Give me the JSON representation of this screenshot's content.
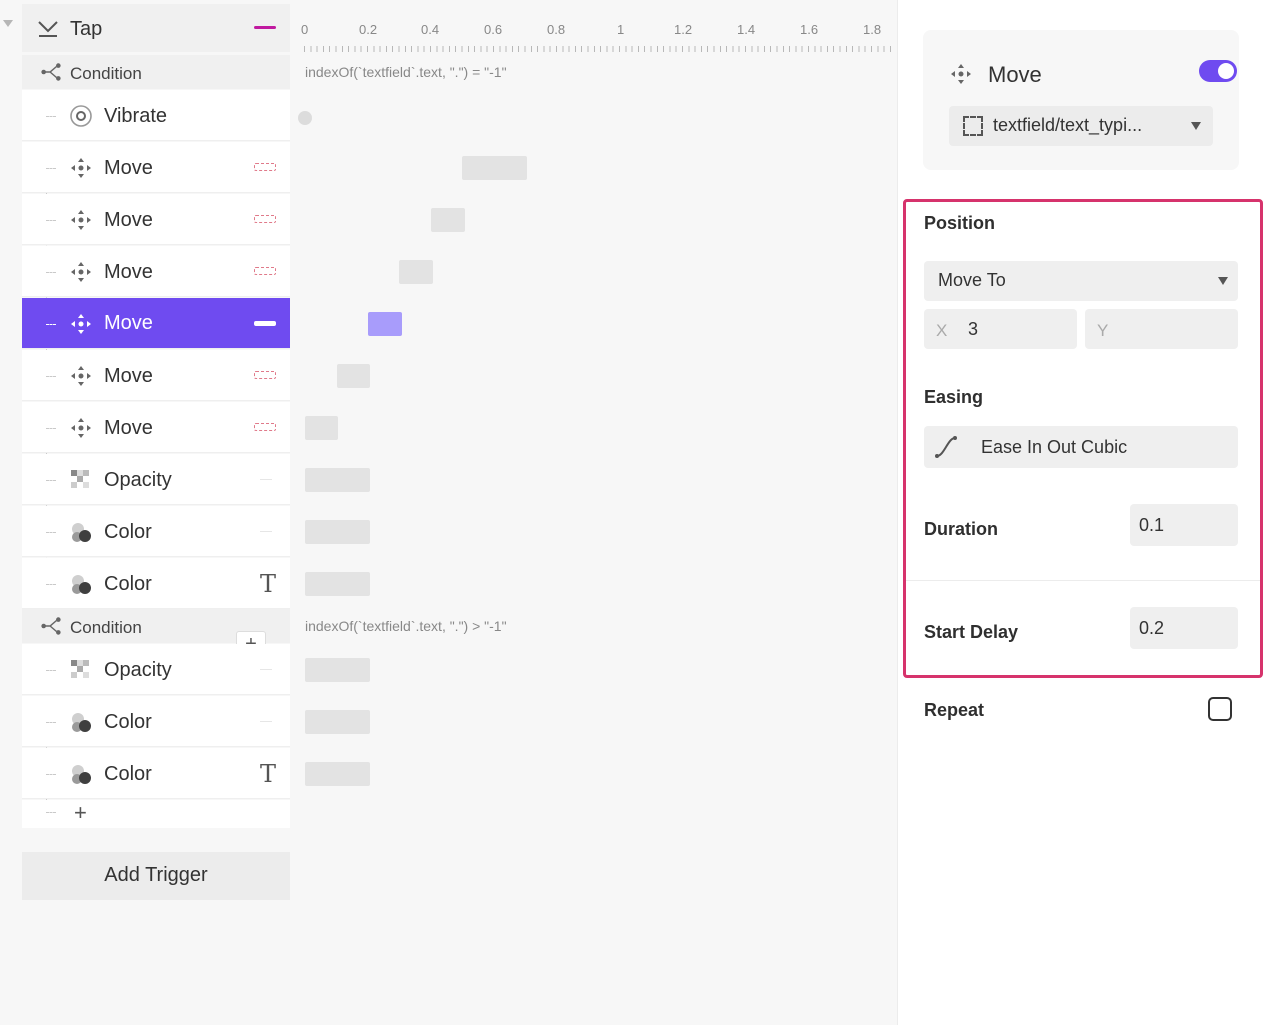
{
  "tree": {
    "trigger_label": "Tap",
    "condition1_label": "Condition",
    "condition2_label": "Condition",
    "items": [
      {
        "label": "Vibrate"
      },
      {
        "label": "Move"
      },
      {
        "label": "Move"
      },
      {
        "label": "Move"
      },
      {
        "label": "Move"
      },
      {
        "label": "Move"
      },
      {
        "label": "Move"
      },
      {
        "label": "Opacity"
      },
      {
        "label": "Color"
      },
      {
        "label": "Color"
      }
    ],
    "items2": [
      {
        "label": "Opacity"
      },
      {
        "label": "Color"
      },
      {
        "label": "Color"
      }
    ],
    "add_plus": "+",
    "text_glyph": "T",
    "add_trigger_label": "Add Trigger"
  },
  "timeline": {
    "ticks": [
      "0",
      "0.2",
      "0.4",
      "0.6",
      "0.8",
      "1",
      "1.2",
      "1.4",
      "1.6",
      "1.8"
    ],
    "condition1_expr": "indexOf(`textfield`.text, \".\") = \"-1\"",
    "condition2_expr": "indexOf(`textfield`.text, \".\") > \"-1\""
  },
  "panel": {
    "action_title": "Move",
    "toggle_on": true,
    "target_label": "textfield/text_typi...",
    "position_title": "Position",
    "position_mode": "Move To",
    "x_label": "X",
    "x_value": "3",
    "y_label": "Y",
    "easing_title": "Easing",
    "easing_value": "Ease In Out Cubic",
    "duration_label": "Duration",
    "duration_value": "0.1",
    "start_delay_label": "Start Delay",
    "start_delay_value": "0.2",
    "repeat_label": "Repeat",
    "repeat_checked": false
  },
  "colors": {
    "accent": "#6f4bf0",
    "highlight": "#d6336c",
    "trigger_marker": "#c0199f"
  }
}
